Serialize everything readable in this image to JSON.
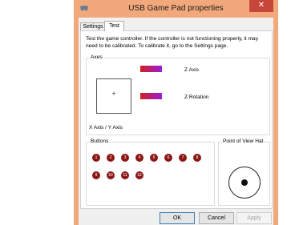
{
  "window": {
    "title": "USB Game Pad  properties",
    "close_glyph": "✕",
    "app_icon": "gamepad-icon"
  },
  "tabs": [
    {
      "label": "Settings",
      "selected": false
    },
    {
      "label": "Test",
      "selected": true
    }
  ],
  "intro_text": "Test the game controller.  If the controller is not functioning properly, it may need to be calibrated.  To calibrate it, go to the Settings page.",
  "axes": {
    "group_label": "Axes",
    "xy_label": "X Axis / Y Axis",
    "xy_marker": "+",
    "z_axis_label": "Z Axis",
    "z_rotation_label": "Z Rotation",
    "bar_colors": [
      "#d21f1f",
      "#9b1fd6"
    ]
  },
  "buttons": {
    "group_label": "Buttons",
    "items": [
      "1",
      "2",
      "3",
      "4",
      "5",
      "6",
      "7",
      "8",
      "9",
      "10",
      "11",
      "12"
    ],
    "color": "#8b1616"
  },
  "pov": {
    "group_label": "Point of View Hat"
  },
  "footer": {
    "ok_label": "OK",
    "cancel_label": "Cancel",
    "apply_label": "Apply"
  }
}
